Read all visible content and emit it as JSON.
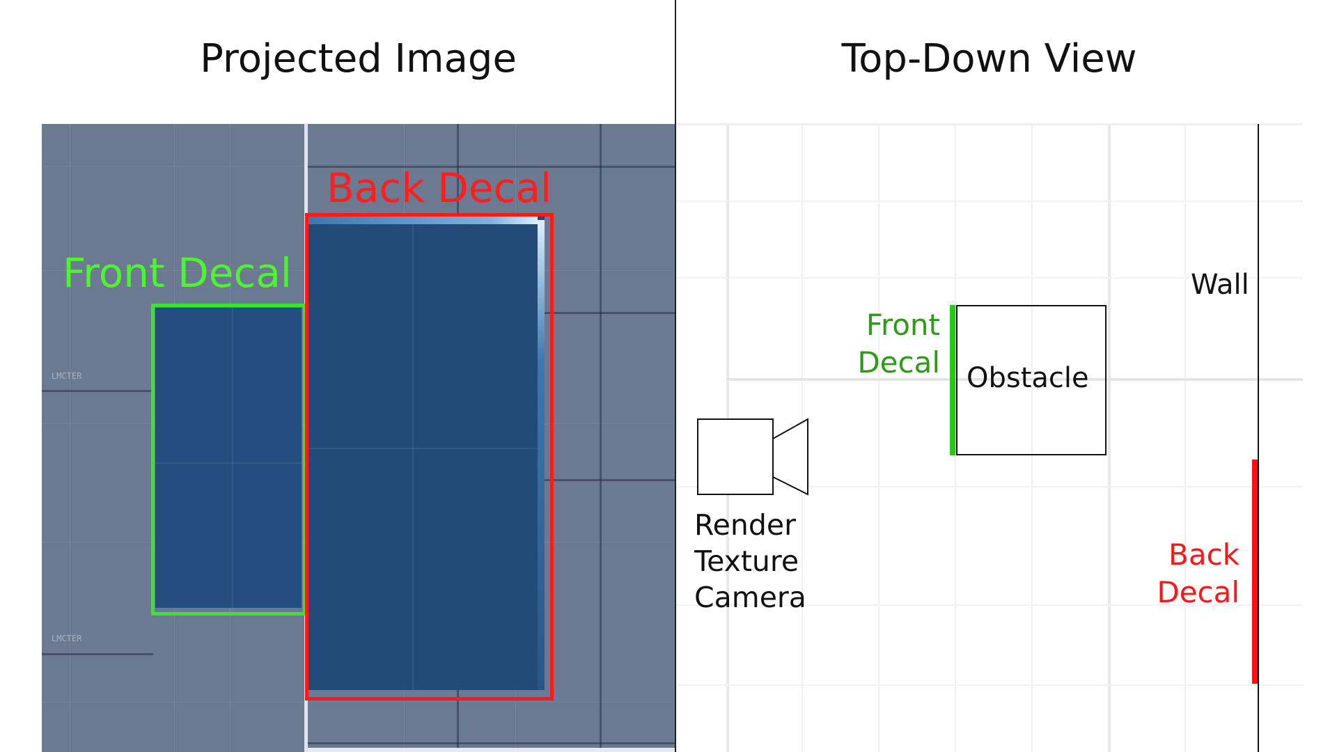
{
  "panels": {
    "left_title": "Projected Image",
    "right_title": "Top-Down View"
  },
  "projected": {
    "front_label": "Front Decal",
    "back_label": "Back Decal",
    "front_color": "#39e62b",
    "back_color": "#ff1a1a",
    "floor_color": "#6b7991",
    "object_color": "#234d7b"
  },
  "topdown": {
    "wall_label": "Wall",
    "obstacle_label": "Obstacle",
    "front_decal_label": "Front\nDecal",
    "back_decal_label": "Back\nDecal",
    "camera_label": "Render\nTexture\nCamera",
    "front_color": "#22cc11",
    "back_color": "#ff1010",
    "icon": "camera-icon"
  }
}
